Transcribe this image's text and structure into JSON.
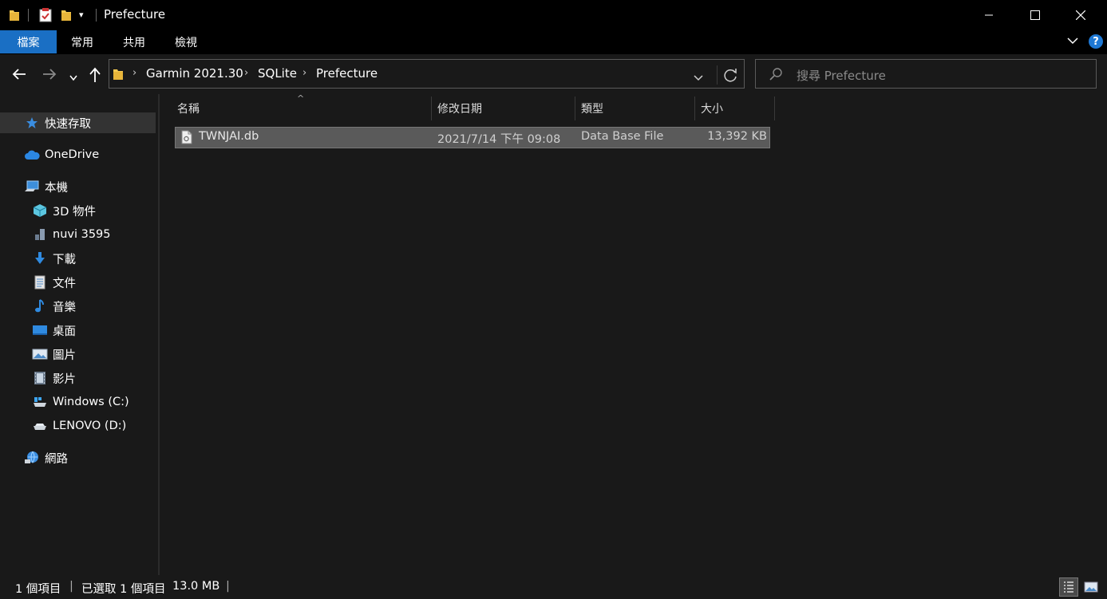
{
  "window": {
    "title": "Prefecture",
    "colors": {
      "accent": "#1a6fc4",
      "titlebar": "#000000",
      "background": "#191919",
      "selection": "#5a5a5a",
      "help": "#1e78d4"
    }
  },
  "ribbon": {
    "tabs": [
      {
        "label": "檔案"
      },
      {
        "label": "常用"
      },
      {
        "label": "共用"
      },
      {
        "label": "檢視"
      }
    ]
  },
  "address": {
    "crumbs": [
      "Garmin 2021.30",
      "SQLite",
      "Prefecture"
    ]
  },
  "search": {
    "placeholder": "搜尋 Prefecture"
  },
  "nav": {
    "items": [
      {
        "label": "快速存取",
        "icon": "star-icon"
      },
      {
        "label": "OneDrive",
        "icon": "cloud-icon"
      },
      {
        "label": "本機",
        "icon": "computer-icon"
      },
      {
        "label": "3D 物件",
        "icon": "cube-icon"
      },
      {
        "label": "nuvi 3595",
        "icon": "device-icon"
      },
      {
        "label": "下載",
        "icon": "download-icon"
      },
      {
        "label": "文件",
        "icon": "document-icon"
      },
      {
        "label": "音樂",
        "icon": "music-icon"
      },
      {
        "label": "桌面",
        "icon": "desktop-icon"
      },
      {
        "label": "圖片",
        "icon": "pictures-icon"
      },
      {
        "label": "影片",
        "icon": "videos-icon"
      },
      {
        "label": "Windows (C:)",
        "icon": "drive-c-icon"
      },
      {
        "label": "LENOVO (D:)",
        "icon": "drive-d-icon"
      },
      {
        "label": "網路",
        "icon": "network-icon"
      }
    ]
  },
  "columns": {
    "name": "名稱",
    "modified": "修改日期",
    "type": "類型",
    "size": "大小"
  },
  "files": [
    {
      "name": "TWNJAI.db",
      "modified": "2021/7/14 下午 09:08",
      "type": "Data Base File",
      "size": "13,392 KB"
    }
  ],
  "status": {
    "count": "1 個項目",
    "selected": "已選取 1 個項目",
    "size": "13.0 MB"
  }
}
